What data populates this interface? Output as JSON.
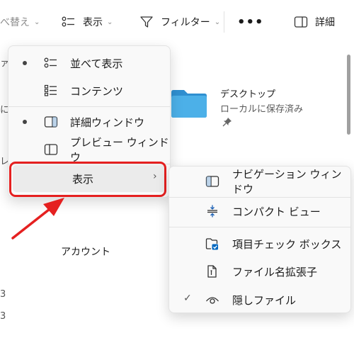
{
  "toolbar": {
    "sort_label": "べ替え",
    "view_label": "表示",
    "filter_label": "フィルター",
    "more_label": "•••",
    "details_label": "詳細"
  },
  "explorer": {
    "folder_name": "デスクトップ",
    "folder_status": "ローカルに保存済み",
    "account_label": "アカウント"
  },
  "view_menu": {
    "items": [
      {
        "label": "並べて表示",
        "selected": true,
        "icon": "tiles-list-icon"
      },
      {
        "label": "コンテンツ",
        "selected": false,
        "icon": "content-list-icon"
      },
      {
        "label": "詳細ウィンドウ",
        "selected": true,
        "icon": "details-pane-icon"
      },
      {
        "label": "プレビュー ウィンドウ",
        "selected": false,
        "icon": "preview-pane-icon"
      }
    ],
    "show_label": "表示"
  },
  "show_submenu": {
    "items": [
      {
        "label": "ナビゲーション ウィンドウ",
        "icon": "navigation-pane-icon",
        "checked": false
      },
      {
        "label": "コンパクト ビュー",
        "icon": "compact-view-icon",
        "checked": false
      },
      {
        "label": "項目チェック ボックス",
        "icon": "item-checkbox-icon",
        "checked": false
      },
      {
        "label": "ファイル名拡張子",
        "icon": "file-extension-icon",
        "checked": false
      },
      {
        "label": "隠しファイル",
        "icon": "hidden-files-icon",
        "checked": true
      }
    ]
  },
  "colors": {
    "highlight": "#e52020",
    "accent": "#0067c0",
    "folder": "#3aa0de"
  }
}
